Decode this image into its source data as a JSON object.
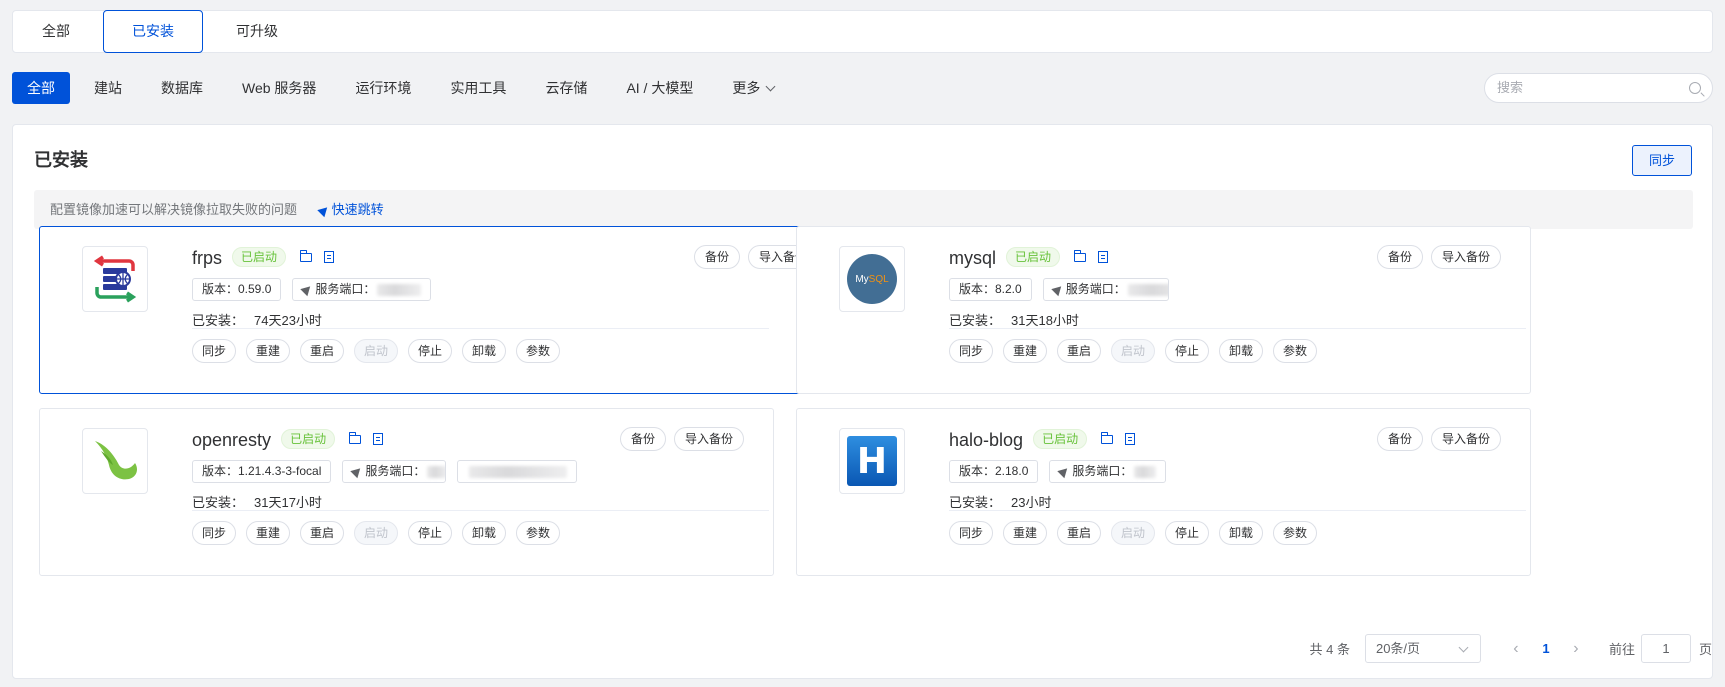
{
  "top_tabs": [
    {
      "label": "全部",
      "active": false
    },
    {
      "label": "已安装",
      "active": true
    },
    {
      "label": "可升级",
      "active": false
    }
  ],
  "categories": [
    {
      "label": "全部",
      "active": true
    },
    {
      "label": "建站"
    },
    {
      "label": "数据库"
    },
    {
      "label": "Web 服务器"
    },
    {
      "label": "运行环境"
    },
    {
      "label": "实用工具"
    },
    {
      "label": "云存储"
    },
    {
      "label": "AI / 大模型"
    },
    {
      "label": "更多"
    }
  ],
  "search": {
    "placeholder": "搜索",
    "value": ""
  },
  "panel": {
    "title": "已安装",
    "sync_label": "同步",
    "notice": "配置镜像加速可以解决镜像拉取失败的问题",
    "notice_link": "快速跳转"
  },
  "common": {
    "status": "已启动",
    "backup": "备份",
    "import_backup": "导入备份",
    "installed_label": "已安装：",
    "actions": [
      "同步",
      "重建",
      "重启",
      "启动",
      "停止",
      "卸载",
      "参数"
    ]
  },
  "apps": [
    {
      "name": "frps",
      "version": "版本：0.59.0",
      "port": "服务端口：",
      "installed": "74天23小时",
      "icon": "frps-logo"
    },
    {
      "name": "mysql",
      "version": "版本：8.2.0",
      "port": "服务端口：",
      "installed": "31天18小时",
      "icon": "mysql-logo"
    },
    {
      "name": "openresty",
      "version": "版本：1.21.4.3-3-focal",
      "port": "服务端口：",
      "installed": "31天17小时",
      "icon": "openresty-logo"
    },
    {
      "name": "halo-blog",
      "version": "版本：2.18.0",
      "port": "服务端口：",
      "installed": "23小时",
      "icon": "halo-logo"
    }
  ],
  "mysql_logo_text": {
    "a": "My",
    "b": "SQL"
  },
  "halo_logo_text": "H",
  "pagination": {
    "total": "共 4 条",
    "page_size": "20条/页",
    "current_page": "1",
    "goto_label": "前往",
    "goto_value": "1",
    "page_word": "页"
  },
  "colors": {
    "accent": "#0052d9",
    "status_green": "#67c23a"
  }
}
